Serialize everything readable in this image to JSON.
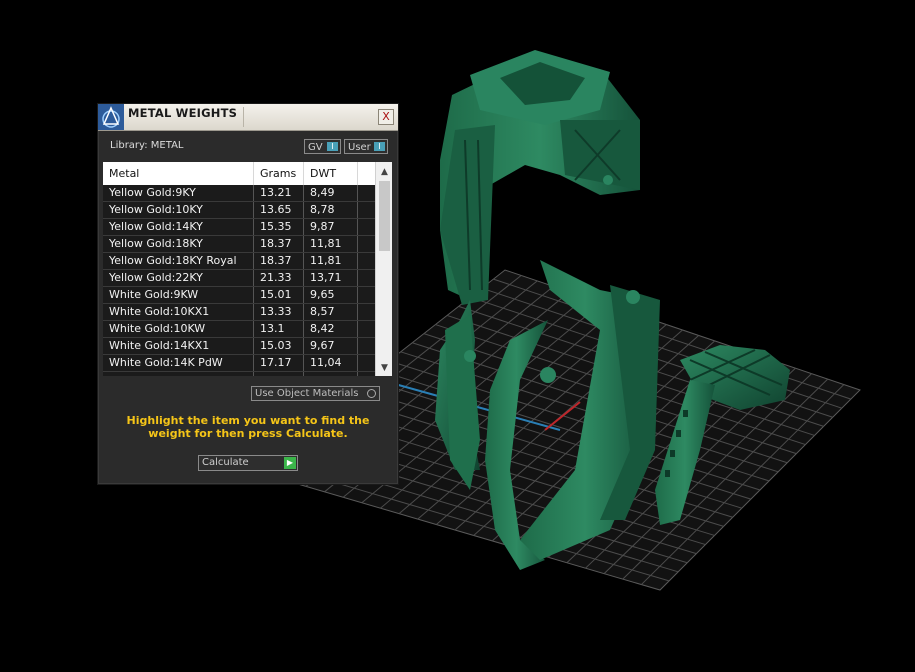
{
  "panel": {
    "title": "METAL WEIGHTS",
    "close_label": "X",
    "library_label": "Library: METAL",
    "gv_label": "GV",
    "user_label": "User",
    "toggle_glyph": "I",
    "columns": [
      "Metal",
      "Grams",
      "DWT"
    ],
    "rows": [
      {
        "metal": "Yellow Gold:9KY",
        "grams": "13.21",
        "dwt": "8,49"
      },
      {
        "metal": "Yellow Gold:10KY",
        "grams": "13.65",
        "dwt": "8,78"
      },
      {
        "metal": "Yellow Gold:14KY",
        "grams": "15.35",
        "dwt": "9,87"
      },
      {
        "metal": "Yellow Gold:18KY",
        "grams": "18.37",
        "dwt": "11,81"
      },
      {
        "metal": "Yellow Gold:18KY Royal",
        "grams": "18.37",
        "dwt": "11,81"
      },
      {
        "metal": "Yellow Gold:22KY",
        "grams": "21.33",
        "dwt": "13,71"
      },
      {
        "metal": "White Gold:9KW",
        "grams": "15.01",
        "dwt": "9,65"
      },
      {
        "metal": "White Gold:10KX1",
        "grams": "13.33",
        "dwt": "8,57"
      },
      {
        "metal": "White Gold:10KW",
        "grams": "13.1",
        "dwt": "8,42"
      },
      {
        "metal": "White Gold:14KX1",
        "grams": "15.03",
        "dwt": "9,67"
      },
      {
        "metal": "White Gold:14K PdW",
        "grams": "17.17",
        "dwt": "11,04"
      }
    ],
    "use_object_materials": "Use Object Materials",
    "hint": "Highlight the item you want to find the weight for then press Calculate.",
    "calculate_label": "Calculate",
    "colors": {
      "hint": "#f5c518",
      "toggle_accent": "#49a0b8",
      "calculate_accent": "#3bb54a",
      "model_green": "#1f6b4a"
    }
  }
}
